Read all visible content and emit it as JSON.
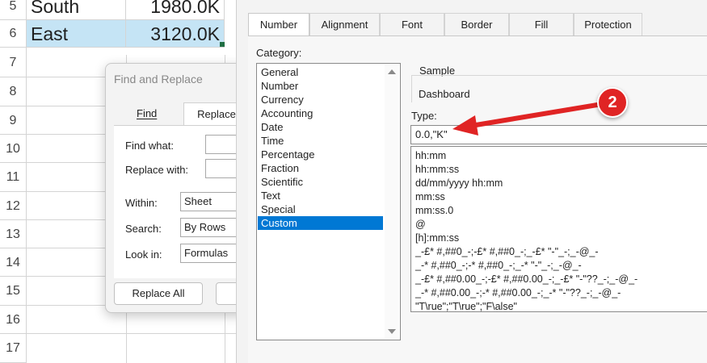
{
  "sheet": {
    "rows": [
      {
        "num": "5",
        "a": "South",
        "b": "1980.0K"
      },
      {
        "num": "6",
        "a": "East",
        "b": "3120.0K"
      },
      {
        "num": "7"
      },
      {
        "num": "8"
      },
      {
        "num": "9"
      },
      {
        "num": "10"
      },
      {
        "num": "11"
      },
      {
        "num": "12"
      },
      {
        "num": "13"
      },
      {
        "num": "14"
      },
      {
        "num": "15"
      },
      {
        "num": "16"
      },
      {
        "num": "17"
      }
    ]
  },
  "find_replace": {
    "title": "Find and Replace",
    "tabs": [
      "Find",
      "Replace"
    ],
    "find_what_label": "Find what:",
    "replace_with_label": "Replace with:",
    "within_label": "Within:",
    "within_value": "Sheet",
    "search_label": "Search:",
    "search_value": "By Rows",
    "look_in_label": "Look in:",
    "look_in_value": "Formulas",
    "replace_all_label": "Replace All"
  },
  "format_cells": {
    "tabs": [
      "Number",
      "Alignment",
      "Font",
      "Border",
      "Fill",
      "Protection"
    ],
    "category_label": "Category:",
    "categories": [
      "General",
      "Number",
      "Currency",
      "Accounting",
      "Date",
      "Time",
      "Percentage",
      "Fraction",
      "Scientific",
      "Text",
      "Special",
      "Custom"
    ],
    "selected_category": "Custom",
    "sample_label": "Sample",
    "sample_value": "Dashboard",
    "type_label": "Type:",
    "type_value": "0.0,\"K\"",
    "formats": [
      "hh:mm",
      "hh:mm:ss",
      "dd/mm/yyyy hh:mm",
      "mm:ss",
      "mm:ss.0",
      "@",
      "[h]:mm:ss",
      "_-£* #,##0_-;-£* #,##0_-;_-£* \"-\"_-;_-@_-",
      "_-* #,##0_-;-* #,##0_-;_-* \"-\"_-;_-@_-",
      "_-£* #,##0.00_-;-£* #,##0.00_-;_-£* \"-\"??_-;_-@_-",
      "_-* #,##0.00_-;-* #,##0.00_-;_-* \"-\"??_-;_-@_-",
      "\"T\\rue\";\"T\\rue\";\"F\\alse\""
    ]
  },
  "annotation": {
    "badge": "2",
    "color": "#e02424"
  }
}
